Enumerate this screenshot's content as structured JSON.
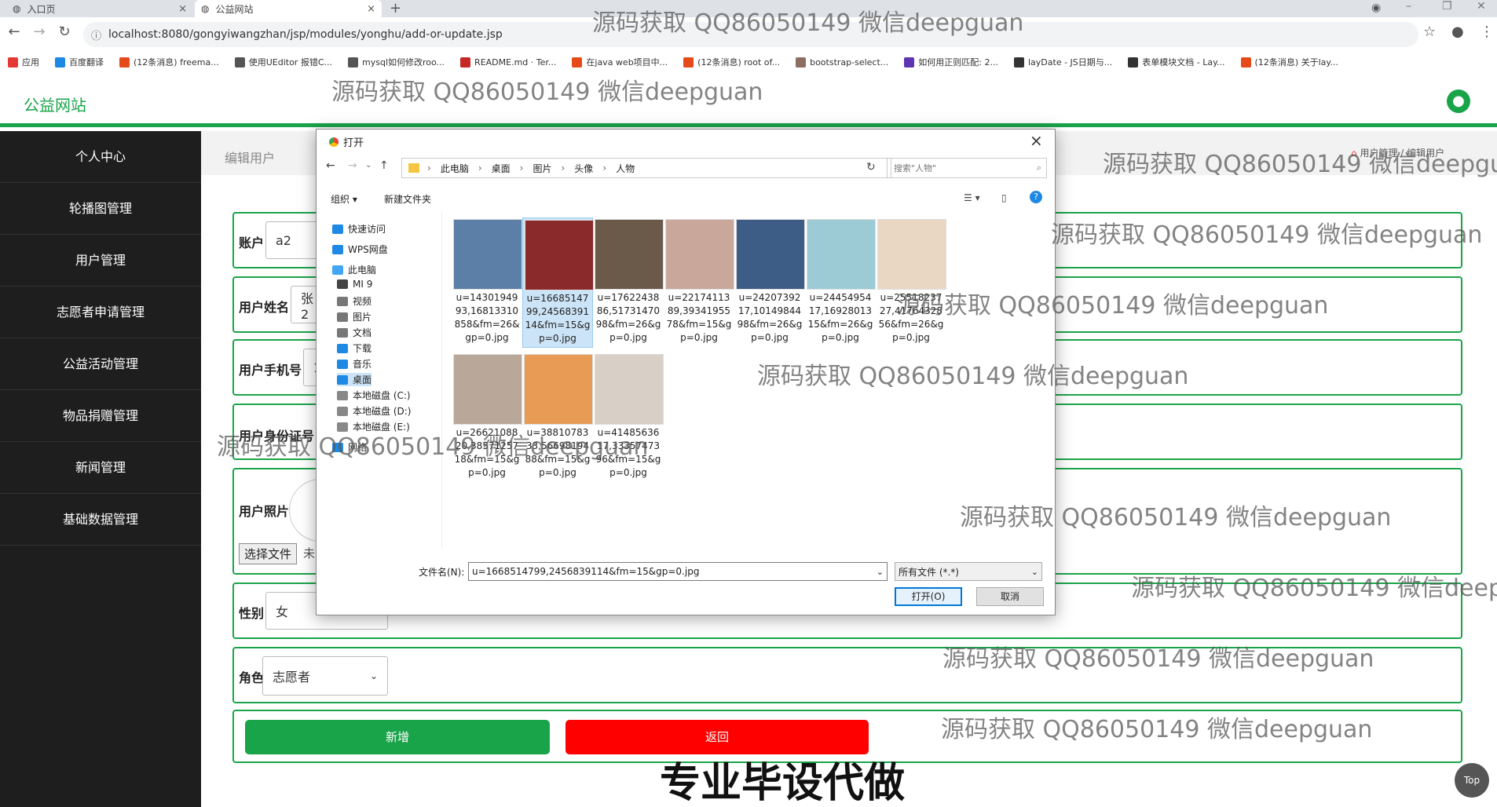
{
  "browser": {
    "tabs": [
      {
        "title": "入口页",
        "close": "×"
      },
      {
        "title": "公益网站",
        "close": "×"
      }
    ],
    "new_tab": "+",
    "url": "localhost:8080/gongyiwangzhan/jsp/modules/yonghu/add-or-update.jsp",
    "bookmarks": [
      {
        "label": "应用",
        "color": "#e53935"
      },
      {
        "label": "百度翻译",
        "color": "#1e88e5"
      },
      {
        "label": "(12条消息) freema...",
        "color": "#e64a19"
      },
      {
        "label": "使用UEditor 报错C...",
        "color": "#555555"
      },
      {
        "label": "mysql如何修改roo...",
        "color": "#555555"
      },
      {
        "label": "README.md · Ter...",
        "color": "#c62828"
      },
      {
        "label": "在java web项目中...",
        "color": "#e64a19"
      },
      {
        "label": "(12条消息) root of...",
        "color": "#e64a19"
      },
      {
        "label": "bootstrap-select...",
        "color": "#8d6e63"
      },
      {
        "label": "如何用正则匹配: 2...",
        "color": "#5e35b1"
      },
      {
        "label": "layDate - JS日期与...",
        "color": "#333333"
      },
      {
        "label": "表单模块文档 - Lay...",
        "color": "#333333"
      },
      {
        "label": "(12条消息) 关于lay...",
        "color": "#e64a19"
      }
    ]
  },
  "header": {
    "brand": "公益网站"
  },
  "sidebar": {
    "items": [
      {
        "label": "个人中心"
      },
      {
        "label": "轮播图管理"
      },
      {
        "label": "用户管理"
      },
      {
        "label": "志愿者申请管理"
      },
      {
        "label": "公益活动管理"
      },
      {
        "label": "物品捐赠管理"
      },
      {
        "label": "新闻管理"
      },
      {
        "label": "基础数据管理"
      }
    ]
  },
  "breadcrumb": {
    "title": "编辑用户",
    "right": "用户管理 / 编辑用户"
  },
  "form": {
    "account_label": "账户",
    "account_value": "a2",
    "name_label": "用户姓名",
    "name_value": "张2",
    "phone_label": "用户手机号",
    "phone_value": "1",
    "idcard_label": "用户身份证号",
    "photo_label": "用户照片",
    "choose_file": "选择文件",
    "no_file": "未",
    "gender_label": "性别",
    "gender_value": "女",
    "role_label": "角色",
    "role_value": "志愿者",
    "add_button": "新增",
    "back_button": "返回"
  },
  "top_button": "Top",
  "dialog": {
    "title": "打开",
    "path": [
      "此电脑",
      "桌面",
      "图片",
      "头像",
      "人物"
    ],
    "search_placeholder": "搜索\"人物\"",
    "organize": "组织 ▾",
    "new_folder": "新建文件夹",
    "nav": [
      {
        "label": "快速访问",
        "color": "#1e88e5"
      },
      {
        "label": "WPS网盘",
        "color": "#1e88e5"
      },
      {
        "label": "此电脑",
        "color": "#42a5f5"
      },
      {
        "label": "MI 9",
        "color": "#444444"
      },
      {
        "label": "视频",
        "color": "#777777"
      },
      {
        "label": "图片",
        "color": "#777777"
      },
      {
        "label": "文档",
        "color": "#777777"
      },
      {
        "label": "下载",
        "color": "#1e88e5"
      },
      {
        "label": "音乐",
        "color": "#1e88e5"
      },
      {
        "label": "桌面",
        "color": "#1e88e5"
      },
      {
        "label": "本地磁盘 (C:)",
        "color": "#888888"
      },
      {
        "label": "本地磁盘 (D:)",
        "color": "#888888"
      },
      {
        "label": "本地磁盘 (E:)",
        "color": "#888888"
      },
      {
        "label": "网络",
        "color": "#1e88e5"
      }
    ],
    "files": [
      {
        "name": "u=1430194993,16813310858&fm=26&gp=0.jpg",
        "color": "#5b7fa6"
      },
      {
        "name": "u=1668514799,2456839114&fm=15&gp=0.jpg",
        "color": "#8a2a2a"
      },
      {
        "name": "u=1762243886,5173147098&fm=26&gp=0.jpg",
        "color": "#6b5a4a"
      },
      {
        "name": "u=2217411389,3934195578&fm=15&gp=0.jpg",
        "color": "#c9a79a"
      },
      {
        "name": "u=2420739217,1014984498&fm=26&gp=0.jpg",
        "color": "#3e5d86"
      },
      {
        "name": "u=2445495417,1692801315&fm=26&gp=0.jpg",
        "color": "#9ccbd6"
      },
      {
        "name": "u=2551823727,4176432856&fm=26&gp=0.jpg",
        "color": "#e9d7c4"
      },
      {
        "name": "u=2662108820,3857125718&fm=15&gp=0.jpg",
        "color": "#b9a89a"
      },
      {
        "name": "u=3881078333,5669819488&fm=15&gp=0.jpg",
        "color": "#e79b55"
      },
      {
        "name": "u=4148563617,3335747396&fm=15&gp=0.jpg",
        "color": "#d8cfc6"
      }
    ],
    "filename_label": "文件名(N):",
    "filename_value": "u=1668514799,2456839114&fm=15&gp=0.jpg",
    "filetype": "所有文件 (*.*)",
    "open_button": "打开(O)",
    "cancel_button": "取消"
  },
  "watermark": "源码获取 QQ86050149 微信deepguan",
  "promo": "专业毕设代做"
}
